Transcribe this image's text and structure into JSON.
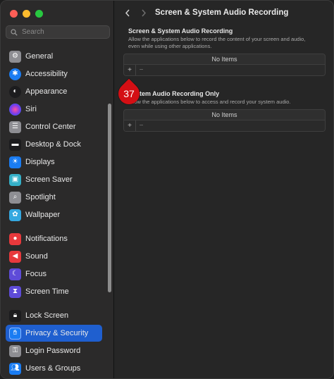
{
  "search": {
    "placeholder": "Search"
  },
  "sidebar": {
    "items": [
      {
        "label": "General",
        "color": "#8e8e93"
      },
      {
        "label": "Accessibility",
        "color": "#1a7cf2"
      },
      {
        "label": "Appearance",
        "color": "#1c1c1e"
      },
      {
        "label": "Siri",
        "color": "#8b3ad6"
      },
      {
        "label": "Control Center",
        "color": "#8e8e93"
      },
      {
        "label": "Desktop & Dock",
        "color": "#1c1c1e"
      },
      {
        "label": "Displays",
        "color": "#1a7cf2"
      },
      {
        "label": "Screen Saver",
        "color": "#35b0c8"
      },
      {
        "label": "Spotlight",
        "color": "#8e8e93"
      },
      {
        "label": "Wallpaper",
        "color": "#35a8e0"
      },
      {
        "label": "Notifications",
        "color": "#e8393c"
      },
      {
        "label": "Sound",
        "color": "#e8393c"
      },
      {
        "label": "Focus",
        "color": "#5e4bd8"
      },
      {
        "label": "Screen Time",
        "color": "#5e4bd8"
      },
      {
        "label": "Lock Screen",
        "color": "#1c1c1e"
      },
      {
        "label": "Privacy & Security",
        "color": "#1a7cf2",
        "selected": true
      },
      {
        "label": "Login Password",
        "color": "#8e8e93"
      },
      {
        "label": "Users & Groups",
        "color": "#1a7cf2"
      }
    ]
  },
  "header": {
    "title": "Screen & System Audio Recording"
  },
  "sections": [
    {
      "title": "Screen & System Audio Recording",
      "desc_line1": "Allow the applications below to record the content of your screen and audio,",
      "desc_line2": "even while using other applications.",
      "empty_label": "No Items"
    },
    {
      "title": "System Audio Recording Only",
      "desc_line1": "Allow the applications below to access and record your system audio.",
      "empty_label": "No Items"
    }
  ],
  "controls": {
    "add": "+",
    "remove": "−"
  },
  "badge": {
    "number": "37",
    "color": "#d40f14"
  },
  "accent": "#1f5fcf"
}
